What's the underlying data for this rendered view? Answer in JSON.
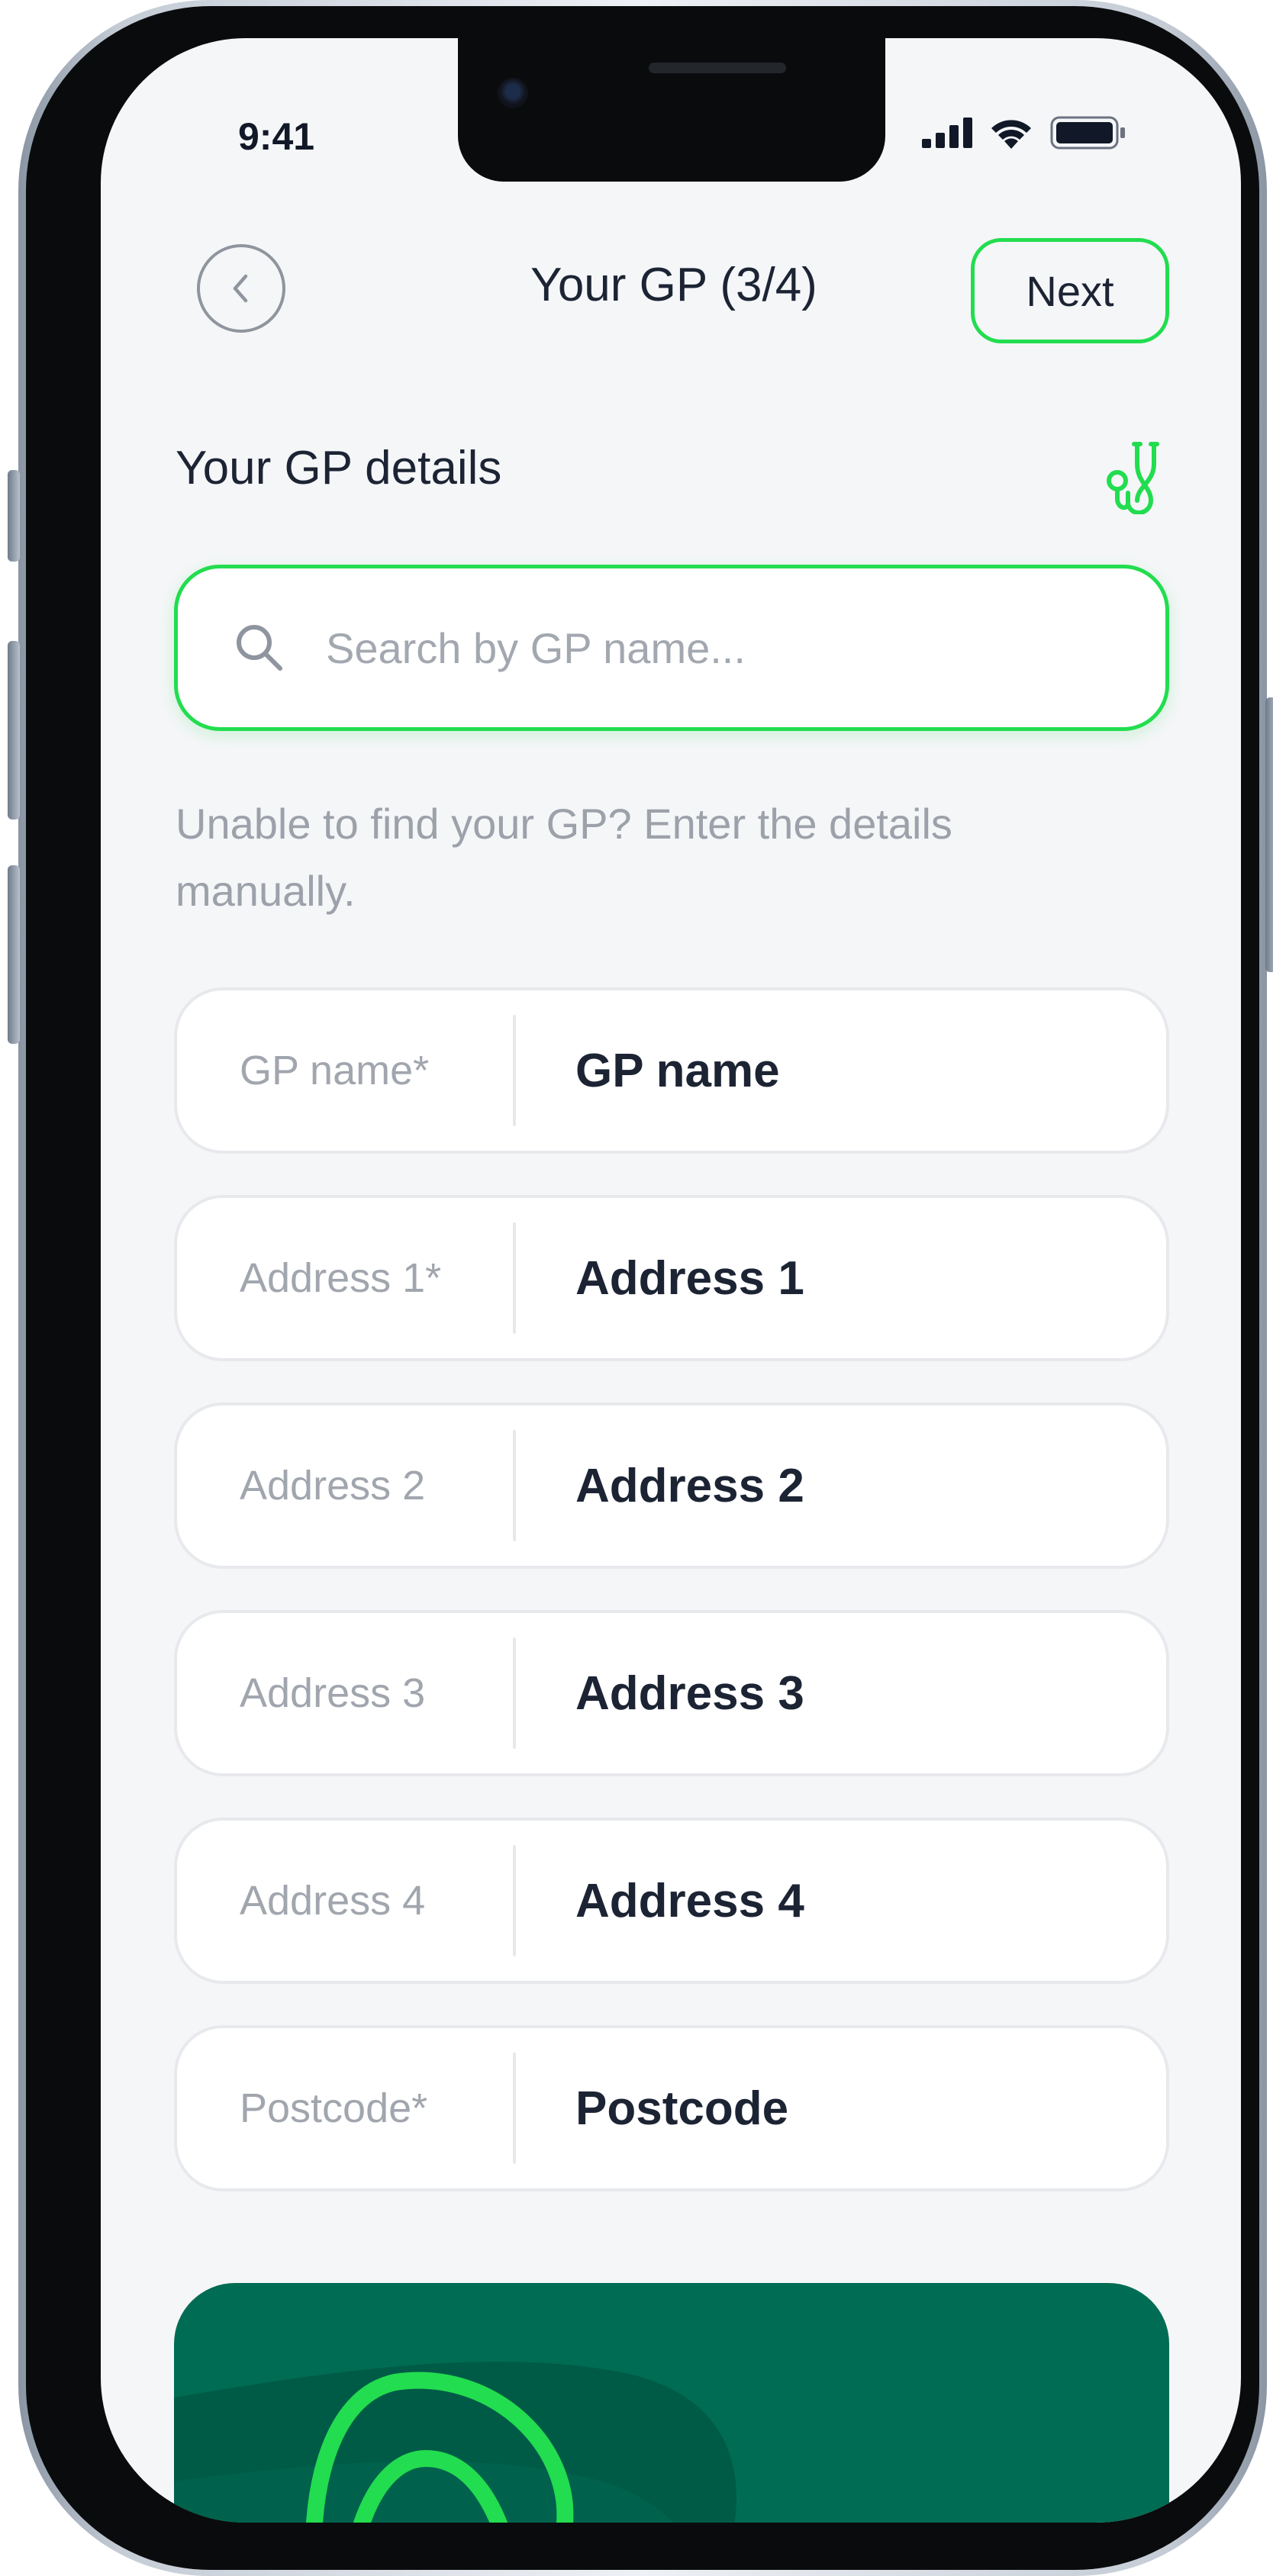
{
  "status_bar": {
    "time": "9:41"
  },
  "header": {
    "title": "Your GP (3/4)",
    "next_label": "Next",
    "back_icon": "chevron-left-icon"
  },
  "section": {
    "title": "Your GP details",
    "icon": "stethoscope-icon"
  },
  "search": {
    "placeholder": "Search by GP name...",
    "value": ""
  },
  "helper_text": "Unable to find your GP? Enter the details manually.",
  "fields": [
    {
      "label": "GP name*",
      "value": "GP name"
    },
    {
      "label": "Address 1*",
      "value": "Address 1"
    },
    {
      "label": "Address 2",
      "value": "Address 2"
    },
    {
      "label": "Address 3",
      "value": "Address 3"
    },
    {
      "label": "Address 4",
      "value": "Address 4"
    },
    {
      "label": "Postcode*",
      "value": "Postcode"
    }
  ],
  "colors": {
    "accent": "#22dd4f",
    "text": "#1c2434",
    "muted": "#9ca1aa",
    "card": "#006c53",
    "background": "#f5f6f8"
  }
}
